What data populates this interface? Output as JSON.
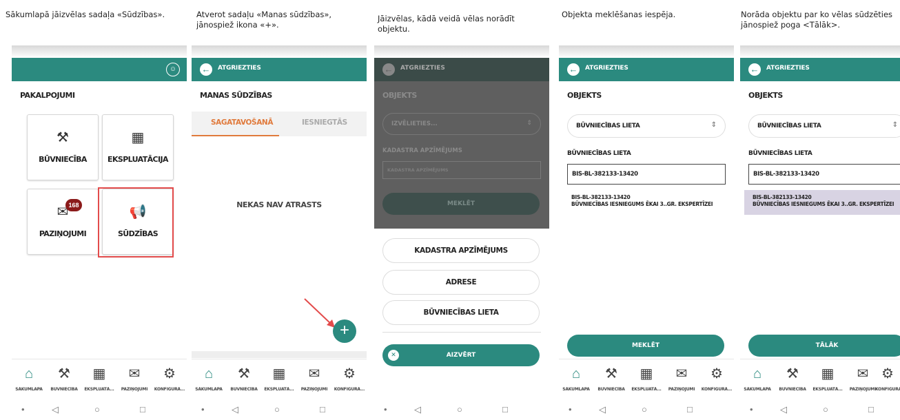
{
  "captions": [
    "Sākumlapā jāizvēlas sadaļa «Sūdzības».",
    "Atverot sadaļu «Manas sūdzības», jānospiež ikona «+».",
    "Jāizvēlas, kādā veidā vēlas norādīt objektu.",
    "Objekta meklēšanas  iespēja.",
    "Norāda objektu par ko vēlas sūdzēties jānospiež poga <Tālāk>."
  ],
  "common": {
    "back_label": "ATGRIEZTIES",
    "nav": [
      "SĀKUMLAPA",
      "BŪVNIECĪBA",
      "EKSPLUATĀ...",
      "PAZIŅOJUMI",
      "KONFIGURĀ..."
    ]
  },
  "screen1": {
    "title": "PAKALPOJUMI",
    "tiles": [
      "BŪVNIECĪBA",
      "EKSPLUATĀCIJA",
      "PAZIŅOJUMI",
      "SŪDZĪBAS"
    ],
    "badge": "168"
  },
  "screen2": {
    "title": "MANAS SŪDZĪBAS",
    "tab_active": "SAGATAVOŠANĀ",
    "tab_inactive": "IESNIEGTĀS",
    "empty": "NEKAS NAV ATRASTS",
    "fab": "+"
  },
  "screen3": {
    "title": "OBJEKTS",
    "select_placeholder": "IZVĒLIETIES...",
    "field_label": "KADASTRA APZĪMĒJUMS",
    "field_placeholder": "KADASTRA APZĪMĒJUMS",
    "search": "MEKLĒT",
    "options": [
      "KADASTRA APZĪMĒJUMS",
      "ADRESE",
      "BŪVNIECĪBAS LIETA"
    ],
    "close": "AIZVĒRT"
  },
  "screen4": {
    "title": "OBJEKTS",
    "select_value": "BŪVNIECĪBAS LIETA",
    "field_label": "BŪVNIECĪBAS LIETA",
    "input_value": "BIS-BL-382133-13420",
    "result_line1": "BIS-BL-382133-13420",
    "result_line2": "BŪVNIECĪBAS IESNIEGUMS ĒKAI 3..GR. EKSPERTĪZEI",
    "button": "MEKLĒT"
  },
  "screen5": {
    "title": "OBJEKTS",
    "select_value": "BŪVNIECĪBAS LIETA",
    "field_label": "BŪVNIECĪBAS LIETA",
    "input_value": "BIS-BL-382133-13420",
    "result_line1": "BIS-BL-382133-13420",
    "result_line2": "BŪVNIECĪBAS IESNIEGUMS ĒKAI 3..GR. EKSPERTĪZEI",
    "button": "TĀLĀK"
  },
  "colors": {
    "accent": "#2b8a7f",
    "tab_active": "#e07a3c",
    "badge": "#8b1a1a",
    "highlight": "#e34b4b",
    "selected_row": "#d8d3e3"
  }
}
